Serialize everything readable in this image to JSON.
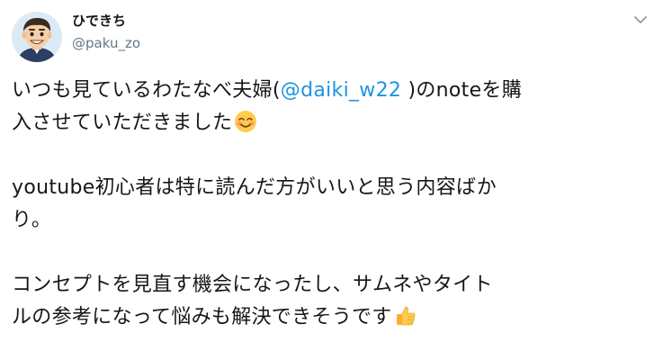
{
  "author": {
    "display_name": "ひできち",
    "handle": "@paku_zo"
  },
  "menu": {
    "caret_icon": "chevron-down-icon"
  },
  "tweet": {
    "p1": {
      "line1_before": "いつも見ているわたなべ夫婦(",
      "mention": "@daiki_w22",
      "line1_after": " )のnoteを購",
      "line2": "入させていただきました",
      "emoji": "smiling-face-with-blush-icon"
    },
    "p2": {
      "line1": "youtube初心者は特に読んだ方がいいと思う内容ばか",
      "line2": "り。"
    },
    "p3": {
      "line1": "コンセプトを見直す機会になったし、サムネやタイト",
      "line2": "ルの参考になって悩みも解決できそうです",
      "emoji": "thumbs-up-icon"
    }
  },
  "colors": {
    "text": "#14171a",
    "secondary": "#657786",
    "link": "#1b95e0",
    "background": "#ffffff"
  }
}
